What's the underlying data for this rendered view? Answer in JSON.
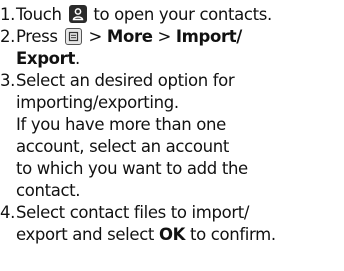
{
  "steps": [
    {
      "number": "1.",
      "text_before_icon": "Touch",
      "icon": "contacts-person-icon",
      "text_after_icon": "to open your contacts."
    },
    {
      "number": "2.",
      "text_before_icon": "Press",
      "icon": "menu-key-icon",
      "sep1": ">",
      "more": "More",
      "sep2": ">",
      "import_export_line1": "Import/",
      "import_export_line2": "Export",
      "period": "."
    },
    {
      "number": "3.",
      "lines": [
        "Select an desired option for",
        "importing/exporting.",
        "If you have more than one",
        "account, select an account",
        "to which you want to add the",
        "contact."
      ]
    },
    {
      "number": "4.",
      "line1": "Select contact files to import/",
      "line2_before": "export and select",
      "ok": "OK",
      "line2_after": "to confirm."
    }
  ]
}
